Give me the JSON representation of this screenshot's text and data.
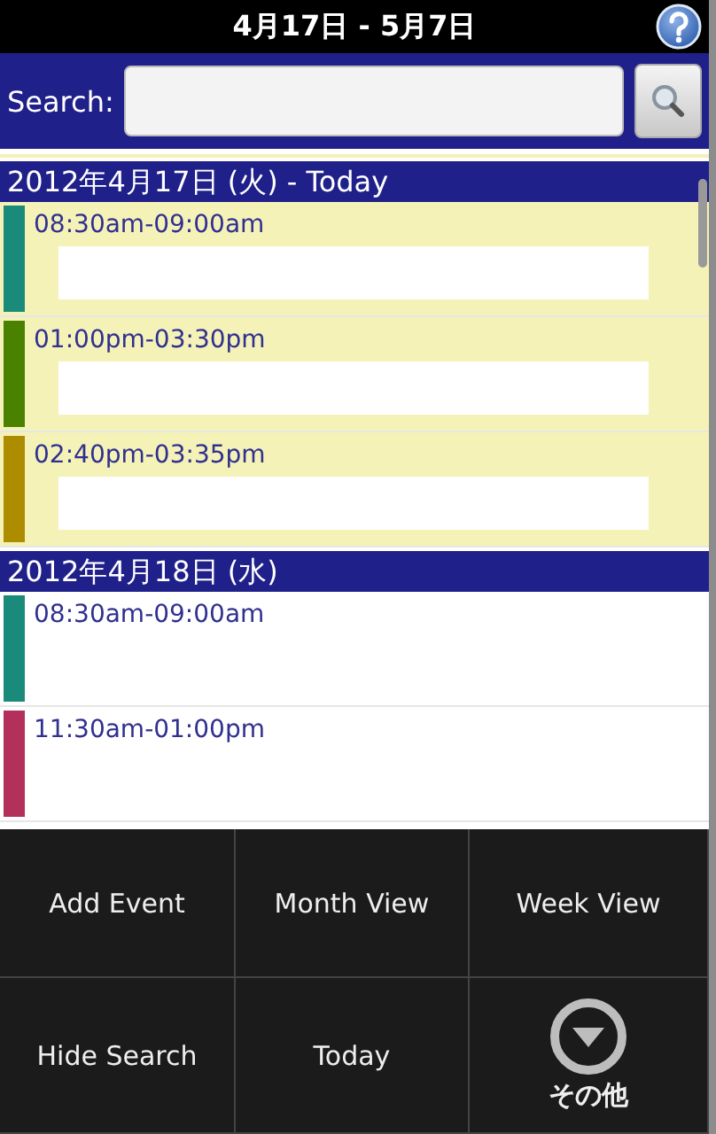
{
  "title_bar": {
    "title": "4月17日 - 5月7日"
  },
  "search": {
    "label": "Search:"
  },
  "days": [
    {
      "heading": "2012年4月17日 (火) - Today",
      "today": true,
      "events": [
        {
          "time": "08:30am-09:00am",
          "color": "#1a8a7a",
          "kind": "masked"
        },
        {
          "time": "01:00pm-03:30pm",
          "color": "#4a8200",
          "kind": "masked"
        },
        {
          "time": "02:40pm-03:35pm",
          "color": "#ad8c00",
          "kind": "masked"
        }
      ]
    },
    {
      "heading": "2012年4月18日 (水)",
      "today": false,
      "events": [
        {
          "time": "08:30am-09:00am",
          "color": "#1a8a7a",
          "kind": "plain"
        },
        {
          "time": "11:30am-01:00pm",
          "color": "#b3305a",
          "kind": "plain"
        }
      ]
    }
  ],
  "menu": [
    {
      "label": "Add Event",
      "kind": "text"
    },
    {
      "label": "Month View",
      "kind": "text"
    },
    {
      "label": "Week View",
      "kind": "text"
    },
    {
      "label": "Hide Search",
      "kind": "text"
    },
    {
      "label": "Today",
      "kind": "text"
    },
    {
      "label": "その他",
      "kind": "more"
    }
  ]
}
